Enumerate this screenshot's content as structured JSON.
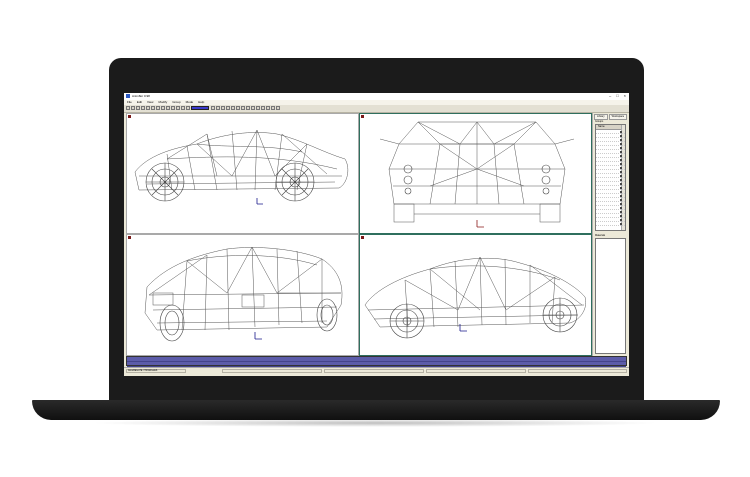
{
  "window": {
    "title": "Anim8or 0.98",
    "controls": {
      "minimize": "–",
      "maximize": "□",
      "close": "×"
    }
  },
  "menu": [
    "File",
    "Edit",
    "View",
    "Modify",
    "Group",
    "Mode",
    "Help"
  ],
  "toolbar_icons": [
    "new-icon",
    "open-icon",
    "save-icon",
    "print-icon",
    "cut-icon",
    "copy-icon",
    "paste-icon",
    "undo-icon",
    "redo-icon",
    "select-icon",
    "move-icon",
    "rotate-icon",
    "scale-icon",
    "mode-selector",
    "line-icon",
    "curve-icon",
    "point-icon",
    "polygon-icon",
    "circle-icon",
    "arc-icon",
    "measure-icon",
    "snap-icon",
    "camera-icon",
    "light-icon",
    "zoom-icon",
    "pan-icon",
    "orbit-icon",
    "fit-icon"
  ],
  "right_panel": {
    "tabs": [
      "Library",
      "Workspace"
    ],
    "section1_label": "Groups",
    "list_header": "Name",
    "list_rows": 24,
    "section2_label": "Materials"
  },
  "console": {
    "lines": [
      "",
      ""
    ]
  },
  "status": {
    "cells": [
      "AGGREGATE / TRIANGLES",
      "",
      "",
      "",
      ""
    ]
  },
  "colors": {
    "console_bg": "#5c5ca9",
    "laptop_bezel": "#1b1b1b",
    "mode_selector": "#3c3ccc"
  }
}
